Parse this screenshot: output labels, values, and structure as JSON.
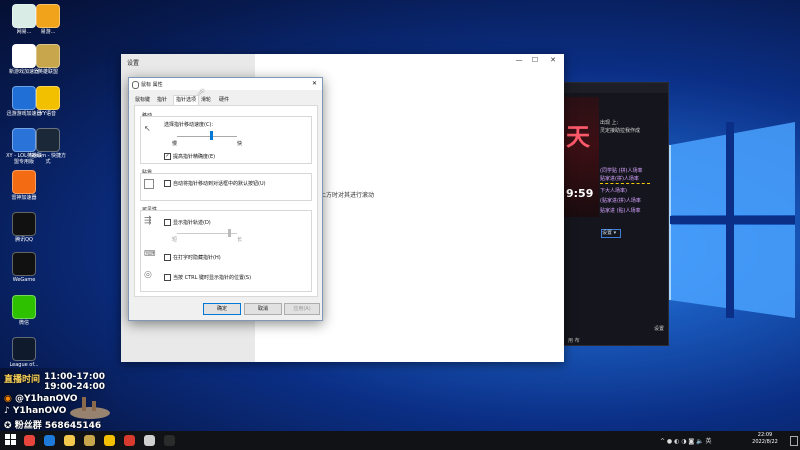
{
  "desktop_icons": [
    {
      "label": "网易...",
      "color": "#d9ece6"
    },
    {
      "label": "易游...",
      "color": "#f2a31c"
    },
    {
      "label": "新游戏加速器",
      "color": "#ffffff"
    },
    {
      "label": "英雄联盟",
      "color": "#c8a64b"
    },
    {
      "label": "迅游游戏加速器",
      "color": "#1f6fd6"
    },
    {
      "label": "YY语音",
      "color": "#f3c000"
    },
    {
      "label": "XY - LOL英雄联盟专用版",
      "color": "#2a74d9"
    },
    {
      "label": "Steam - 快捷方式",
      "color": "#1b2838"
    },
    {
      "label": "雷神加速器",
      "color": "#f36b12"
    },
    {
      "label": "腾讯QQ",
      "color": "#111111"
    },
    {
      "label": "WeGame",
      "color": "#111111"
    },
    {
      "label": "微信",
      "color": "#2dc100"
    },
    {
      "label": "League of...",
      "color": "#0f1b2c"
    }
  ],
  "settings_window": {
    "title": "设置",
    "body_text": "上方时对其进行滚动",
    "controls": {
      "minimize": "—",
      "maximize": "☐",
      "close": "✕"
    }
  },
  "mouse_dialog": {
    "title": "鼠标 属性",
    "close": "✕",
    "tabs": [
      "鼠标键",
      "指针",
      "指针选项",
      "滑轮",
      "硬件"
    ],
    "active_tab": 2,
    "motion": {
      "heading": "移动",
      "speed_label": "选择指针移动速度(C):",
      "slow": "慢",
      "fast": "快",
      "speed_level": 0.55,
      "precision_label": "提高指针精确度(E)",
      "precision_checked": true
    },
    "snap": {
      "heading": "贴靠",
      "label": "自动将指针移动到对话框中的默认按钮(U)",
      "checked": false
    },
    "visibility": {
      "heading": "可见性",
      "trails_label": "显示指针轨迹(D)",
      "trails_short": "短",
      "trails_long": "长",
      "trails_level": 0.85,
      "hide_label": "在打字时隐藏指针(H)",
      "ctrl_label": "当按 CTRL 键时显示指针的位置(S)"
    },
    "buttons": {
      "ok": "确定",
      "cancel": "取消",
      "apply": "应用(A)"
    }
  },
  "right_app": {
    "clock": "9:59",
    "red_text": "天",
    "select_label": "设置",
    "bottom_button": "设置",
    "side_text_1": "用 布",
    "chat_lines": [
      {
        "text": "出现 上:",
        "color": "#d9d9d9"
      },
      {
        "text": "灵定接助拉我作成",
        "color": "#d9d9d9"
      },
      {
        "text": "(同学贴 (拼)人场率",
        "color": "#d7a3ff"
      },
      {
        "text": "贴家进(拼)人场率",
        "color": "#d7a3ff"
      },
      {
        "text": "下大人场率)",
        "color": "#d7a3ff"
      },
      {
        "text": "(贴家进(拼)人场率",
        "color": "#d7a3ff"
      },
      {
        "text": "贴家进 (贴)人场率",
        "color": "#d7a3ff"
      }
    ]
  },
  "overlay": {
    "schedule_label": "直播时间",
    "time1": "11:00-17:00",
    "time2": "19:00-24:00",
    "handle1": "@Y1hanOVO",
    "handle2": "Y1hanOVO",
    "fan_group": "粉丝群 568645146"
  },
  "taskbar": {
    "time": "22:09",
    "date": "2022/8/22",
    "apps": [
      {
        "name": "start",
        "color": "#ffffff"
      },
      {
        "name": "chrome",
        "color": "#e8453c"
      },
      {
        "name": "edge",
        "color": "#1d7ad8"
      },
      {
        "name": "explorer",
        "color": "#f2c94c"
      },
      {
        "name": "lol",
        "color": "#c8a64b"
      },
      {
        "name": "yy",
        "color": "#f3c000"
      },
      {
        "name": "app-red",
        "color": "#d83a2e"
      },
      {
        "name": "settings",
        "color": "#cfcfcf"
      },
      {
        "name": "app-dark",
        "color": "#2b2b2b"
      }
    ]
  }
}
